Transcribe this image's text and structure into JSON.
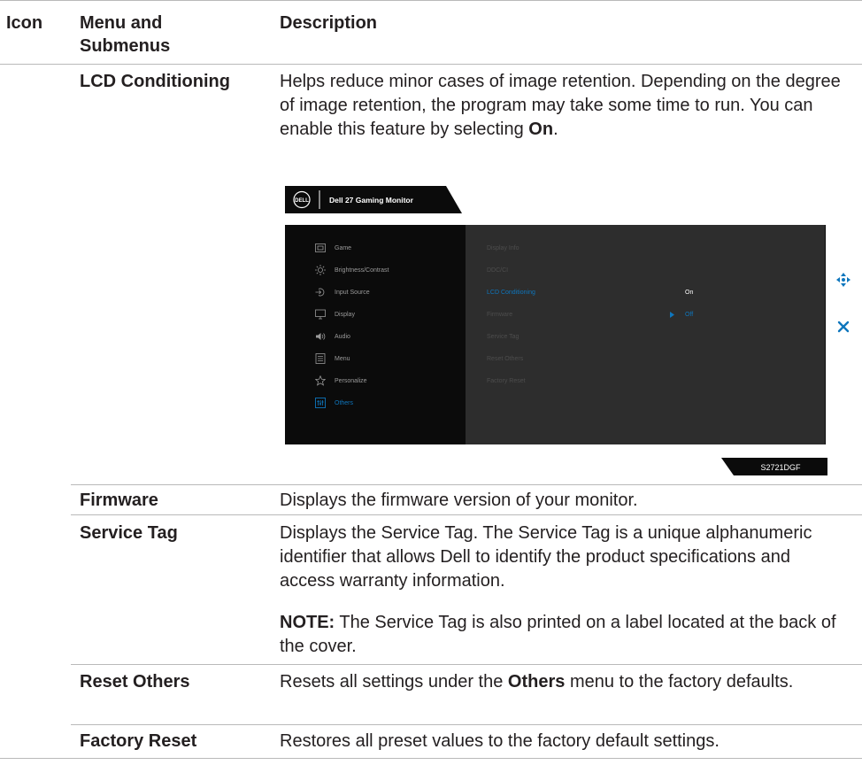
{
  "table": {
    "headers": {
      "icon": "Icon",
      "menu_line1": "Menu and",
      "menu_line2": "Submenus",
      "description": "Description"
    },
    "rows": [
      {
        "name": "LCD Conditioning",
        "description_parts": [
          "Helps reduce minor cases of image retention. Depending on the degree of image retention, the program may take some time to run. You can enable this feature by selecting ",
          "On",
          "."
        ]
      },
      {
        "name": "Firmware",
        "description": "Displays the firmware version of your monitor."
      },
      {
        "name": "Service Tag",
        "description": "Displays the Service Tag. The Service Tag is a unique alphanumeric identifier that allows Dell to identify the product specifications and access warranty information.",
        "note_label": "NOTE:",
        "note_text": " The Service Tag is also printed on a label located at the back of the cover."
      },
      {
        "name": "Reset Others",
        "description_parts": [
          "Resets all settings under the ",
          "Others",
          " menu to the factory defaults."
        ]
      },
      {
        "name": "Factory Reset",
        "description": "Restores all preset values to the factory default settings."
      }
    ]
  },
  "osd": {
    "logo": "DELL",
    "monitor_title": "Dell 27 Gaming Monitor",
    "main_menu": [
      {
        "label": "Game",
        "icon": "game-icon",
        "selected": false
      },
      {
        "label": "Brightness/Contrast",
        "icon": "brightness-icon",
        "selected": false
      },
      {
        "label": "Input Source",
        "icon": "input-source-icon",
        "selected": false
      },
      {
        "label": "Display",
        "icon": "display-icon",
        "selected": false
      },
      {
        "label": "Audio",
        "icon": "audio-icon",
        "selected": false
      },
      {
        "label": "Menu",
        "icon": "menu-icon",
        "selected": false
      },
      {
        "label": "Personalize",
        "icon": "star-icon",
        "selected": false
      },
      {
        "label": "Others",
        "icon": "others-icon",
        "selected": true
      }
    ],
    "submenu": [
      {
        "label": "Display Info",
        "selected": false
      },
      {
        "label": "DDC/CI",
        "selected": false
      },
      {
        "label": "LCD Conditioning",
        "selected": true
      },
      {
        "label": "Firmware",
        "selected": false
      },
      {
        "label": "Service Tag",
        "selected": false
      },
      {
        "label": "Reset Others",
        "selected": false
      },
      {
        "label": "Factory Reset",
        "selected": false
      }
    ],
    "options": {
      "on_label": "On",
      "off_label": "Off"
    },
    "model": "S2721DGF",
    "colors": {
      "accent": "#0e76bd",
      "osd_left_bg": "#0b0b0b",
      "osd_right_bg": "#2d2d2d"
    }
  }
}
